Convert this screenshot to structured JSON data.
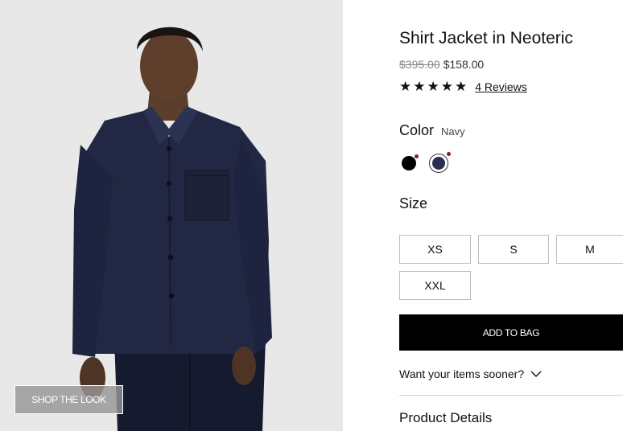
{
  "product": {
    "title": "Shirt Jacket in Neoteric",
    "price_original": "$395.00",
    "price_sale": "$158.00",
    "stars": "★★★★★",
    "rating_value": 5,
    "reviews_link": "4 Reviews"
  },
  "photo": {
    "shop_the_look": "SHOP THE LOOK"
  },
  "color": {
    "label": "Color",
    "selected": "Navy",
    "swatches": [
      {
        "name": "black",
        "hex": "#000000"
      },
      {
        "name": "navy",
        "hex": "#2a2f52",
        "selected": true
      }
    ],
    "swatch_indicator_hex": "#8b1a1a"
  },
  "size": {
    "label": "Size",
    "options": [
      "XS",
      "S",
      "M",
      "XXL"
    ]
  },
  "actions": {
    "add_to_bag": "ADD TO BAG"
  },
  "delivery": {
    "sooner_label": "Want your items sooner?"
  },
  "sections": {
    "product_details": "Product Details"
  }
}
